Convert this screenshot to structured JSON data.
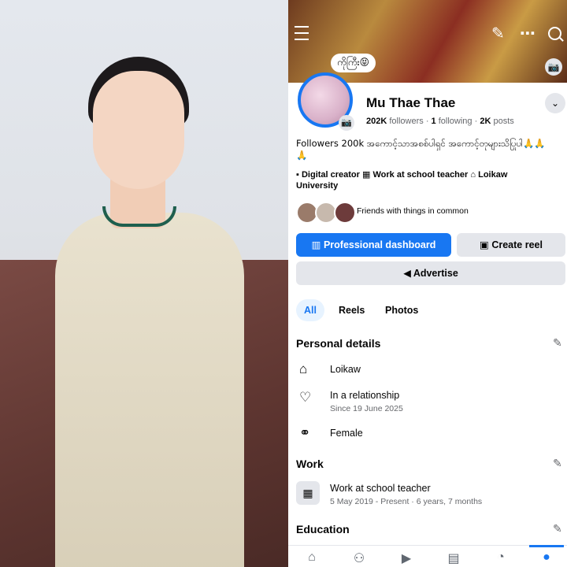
{
  "profile": {
    "cover_bubble": "ကိုကြီး😝",
    "name": "Mu Thae Thae",
    "followers": "202K",
    "followers_label": "followers",
    "following": "1",
    "following_label": "following",
    "posts": "2K",
    "posts_label": "posts",
    "bio": "Followers 200k အကောင့်သာအစစ်ပါရှင် အကောင့်တုများသိပြုပါ🙏🙏🙏",
    "facts": [
      {
        "icon": "briefcase-icon",
        "text": "Digital creator"
      },
      {
        "icon": "work-icon",
        "text": "Work at school teacher"
      },
      {
        "icon": "school-icon",
        "text": "Loikaw University"
      }
    ],
    "friends_text": "Friends with things in common"
  },
  "actions": {
    "professional_dashboard": "Professional dashboard",
    "create_reel": "Create reel",
    "advertise": "Advertise"
  },
  "tabs": [
    "All",
    "Reels",
    "Photos"
  ],
  "personal_details": {
    "title": "Personal details",
    "city": "Loikaw",
    "relationship": "In a relationship",
    "relationship_since": "Since 19 June 2025",
    "gender": "Female"
  },
  "work": {
    "title": "Work",
    "job": "Work at school teacher",
    "period": "5 May 2019 - Present · 6 years, 7 months"
  },
  "education": {
    "title": "Education"
  },
  "colors": {
    "accent": "#1877f2",
    "button_grey": "#e4e6eb",
    "secondary_text": "#65676b"
  },
  "nav_icons": [
    "home-icon",
    "friends-icon",
    "video-icon",
    "marketplace-icon",
    "notifications-icon",
    "profile-icon"
  ]
}
